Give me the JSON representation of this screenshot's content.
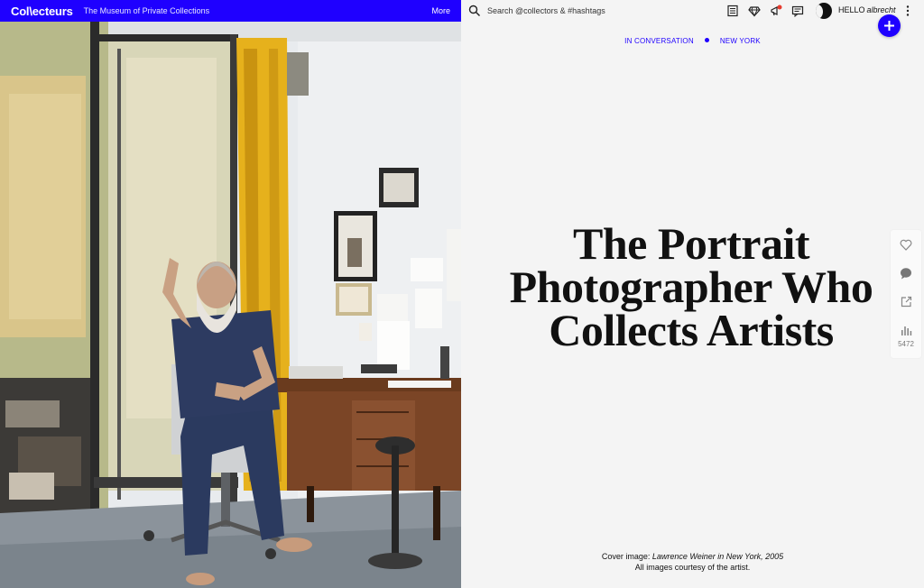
{
  "brand": {
    "logo_text": "Col\\ecteurs",
    "tagline": "The Museum of Private Collections",
    "more_label": "More",
    "accent_color": "#1f00ff"
  },
  "header": {
    "search_placeholder": "Search @collectors & #hashtags",
    "icons": [
      "search-icon",
      "news-icon",
      "diamond-icon",
      "megaphone-icon",
      "message-icon"
    ],
    "greeting": "HELLO",
    "username": "albrecht",
    "plus_label": "+"
  },
  "article": {
    "category": "IN CONVERSATION",
    "location": "NEW YORK",
    "title_lines": [
      "The Portrait",
      "Photographer Who",
      "Collects Artists"
    ],
    "caption_prefix": "Cover image: ",
    "caption_italic": "Lawrence Weiner in New York, 2005",
    "caption_line2": "All images courtesy of the artist."
  },
  "sidebar": {
    "icons": [
      "heart-icon",
      "comment-icon",
      "share-icon",
      "stats-icon"
    ],
    "views_count": "5472"
  }
}
